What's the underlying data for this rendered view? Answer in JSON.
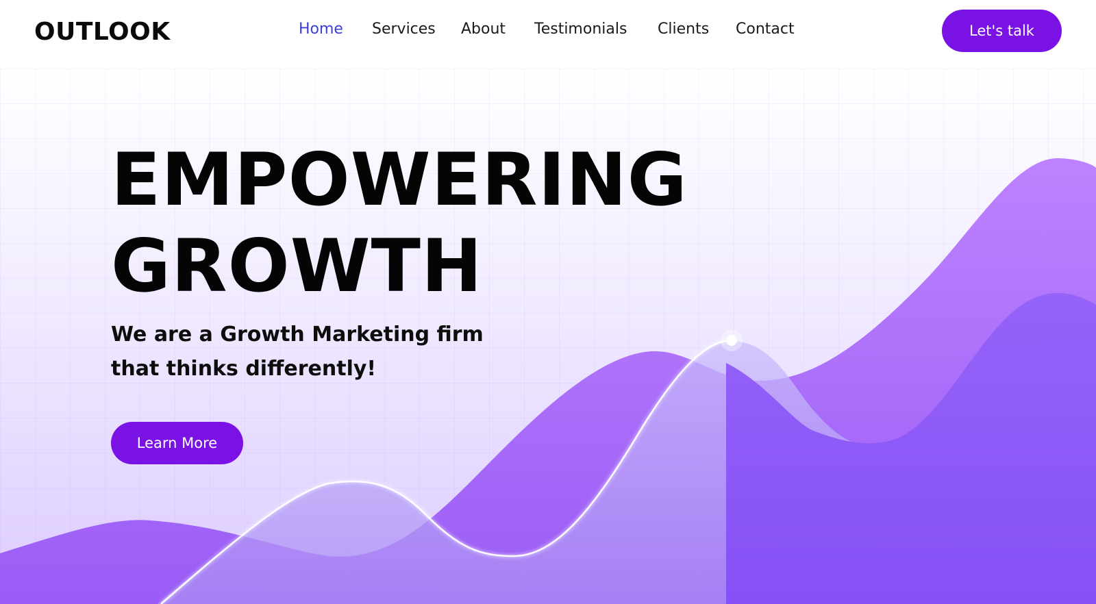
{
  "brand": {
    "logo_text": "OUTLOOK"
  },
  "nav": {
    "items": [
      {
        "label": "Home",
        "active": true
      },
      {
        "label": "Services"
      },
      {
        "label": "About"
      },
      {
        "label": "Testimonials"
      },
      {
        "label": "Clients"
      },
      {
        "label": "Contact"
      }
    ],
    "cta_label": "Let's talk"
  },
  "hero": {
    "headline_line1": "EMPOWERING",
    "headline_line2": "GROWTH",
    "subhead_line1": "We are a Growth Marketing firm",
    "subhead_line2": "that thinks differently!",
    "button_label": "Learn More"
  },
  "colors": {
    "accent": "#7a12e6",
    "nav_active": "#3b3fd9",
    "wave_light": "#b87dff",
    "wave_dark": "#8a52f7"
  }
}
